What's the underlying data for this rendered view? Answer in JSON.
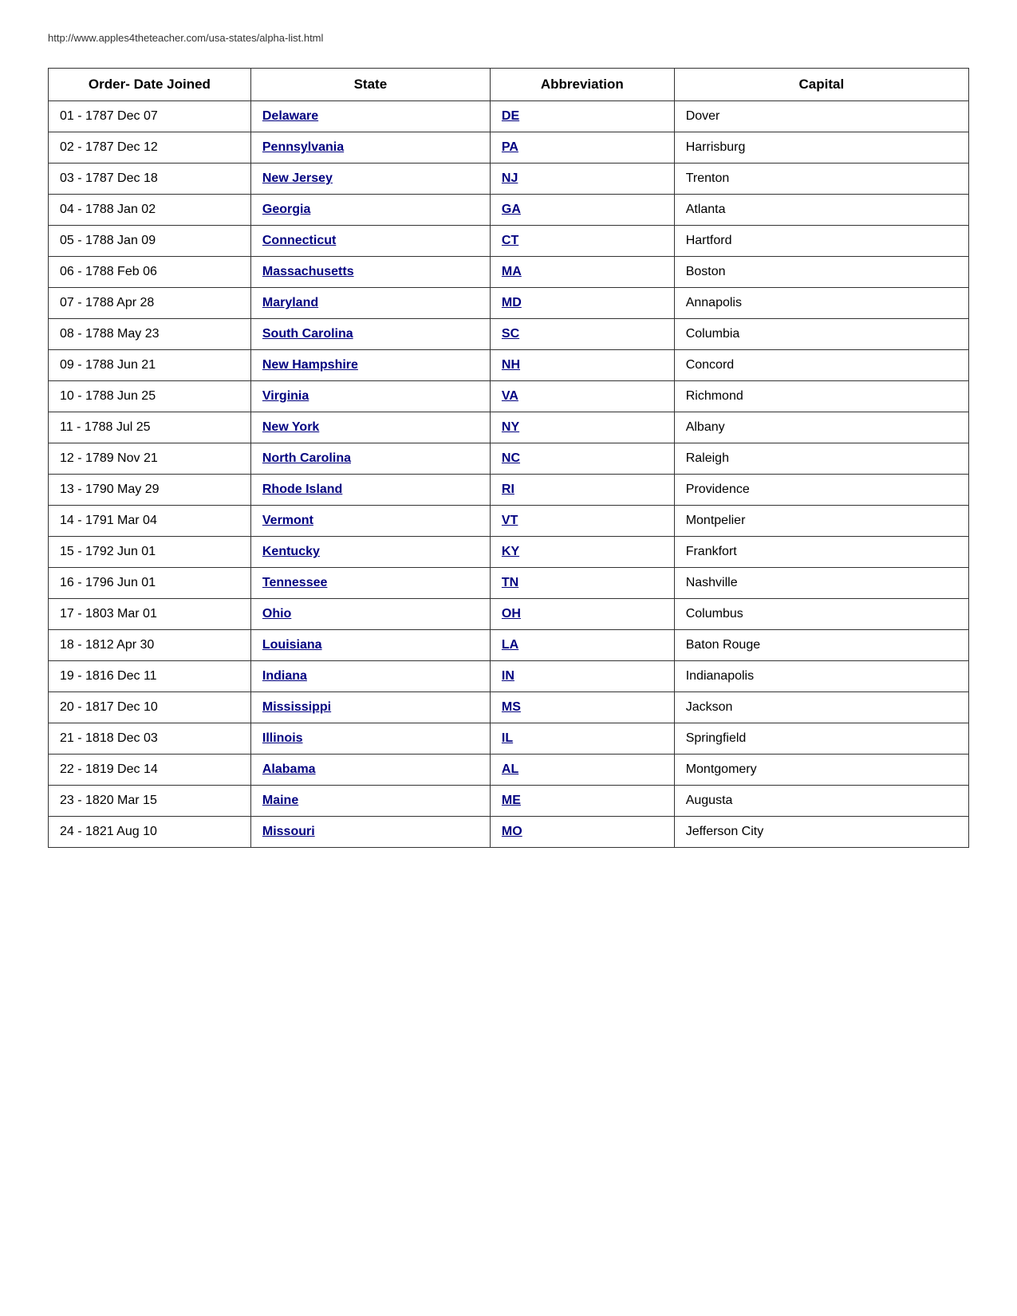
{
  "url": "http://www.apples4theteacher.com/usa-states/alpha-list.html",
  "headers": {
    "order": "Order- Date Joined",
    "state": "State",
    "abbreviation": "Abbreviation",
    "capital": "Capital"
  },
  "rows": [
    {
      "order": "01 - 1787 Dec 07",
      "state": "Delaware",
      "abbr": "DE",
      "capital": "Dover"
    },
    {
      "order": "02 - 1787 Dec 12",
      "state": "Pennsylvania",
      "abbr": "PA",
      "capital": "Harrisburg"
    },
    {
      "order": "03 - 1787 Dec 18",
      "state": "New Jersey",
      "abbr": "NJ",
      "capital": "Trenton"
    },
    {
      "order": "04 - 1788 Jan 02",
      "state": "Georgia",
      "abbr": "GA",
      "capital": "Atlanta"
    },
    {
      "order": "05 - 1788 Jan 09",
      "state": "Connecticut",
      "abbr": "CT",
      "capital": "Hartford"
    },
    {
      "order": "06 - 1788 Feb 06",
      "state": "Massachusetts",
      "abbr": "MA",
      "capital": "Boston"
    },
    {
      "order": "07 - 1788 Apr 28",
      "state": "Maryland",
      "abbr": "MD",
      "capital": "Annapolis"
    },
    {
      "order": "08 - 1788 May 23",
      "state": "South Carolina",
      "abbr": "SC",
      "capital": "Columbia"
    },
    {
      "order": "09 - 1788 Jun 21",
      "state": "New Hampshire",
      "abbr": "NH",
      "capital": "Concord"
    },
    {
      "order": "10 - 1788 Jun 25",
      "state": "Virginia",
      "abbr": "VA",
      "capital": "Richmond"
    },
    {
      "order": "11 - 1788 Jul 25",
      "state": "New York",
      "abbr": "NY",
      "capital": "Albany"
    },
    {
      "order": "12 - 1789 Nov 21",
      "state": "North Carolina",
      "abbr": "NC",
      "capital": "Raleigh"
    },
    {
      "order": "13 - 1790 May 29",
      "state": "Rhode Island",
      "abbr": "RI",
      "capital": "Providence"
    },
    {
      "order": "14 - 1791 Mar 04",
      "state": "Vermont",
      "abbr": "VT",
      "capital": "Montpelier"
    },
    {
      "order": "15 - 1792 Jun 01",
      "state": "Kentucky",
      "abbr": "KY",
      "capital": "Frankfort"
    },
    {
      "order": "16 - 1796 Jun 01",
      "state": "Tennessee",
      "abbr": "TN",
      "capital": "Nashville"
    },
    {
      "order": "17 - 1803 Mar 01",
      "state": "Ohio",
      "abbr": "OH",
      "capital": "Columbus"
    },
    {
      "order": "18 - 1812 Apr 30",
      "state": "Louisiana",
      "abbr": "LA",
      "capital": "Baton Rouge"
    },
    {
      "order": "19 - 1816 Dec 11",
      "state": "Indiana",
      "abbr": "IN",
      "capital": "Indianapolis"
    },
    {
      "order": "20 - 1817 Dec 10",
      "state": "Mississippi",
      "abbr": "MS",
      "capital": "Jackson"
    },
    {
      "order": "21 - 1818 Dec 03",
      "state": "Illinois",
      "abbr": "IL",
      "capital": "Springfield"
    },
    {
      "order": "22 - 1819 Dec 14",
      "state": "Alabama",
      "abbr": "AL",
      "capital": "Montgomery"
    },
    {
      "order": "23 - 1820 Mar 15",
      "state": "Maine",
      "abbr": "ME",
      "capital": "Augusta"
    },
    {
      "order": "24 - 1821 Aug 10",
      "state": "Missouri",
      "abbr": "MO",
      "capital": "Jefferson City"
    }
  ]
}
